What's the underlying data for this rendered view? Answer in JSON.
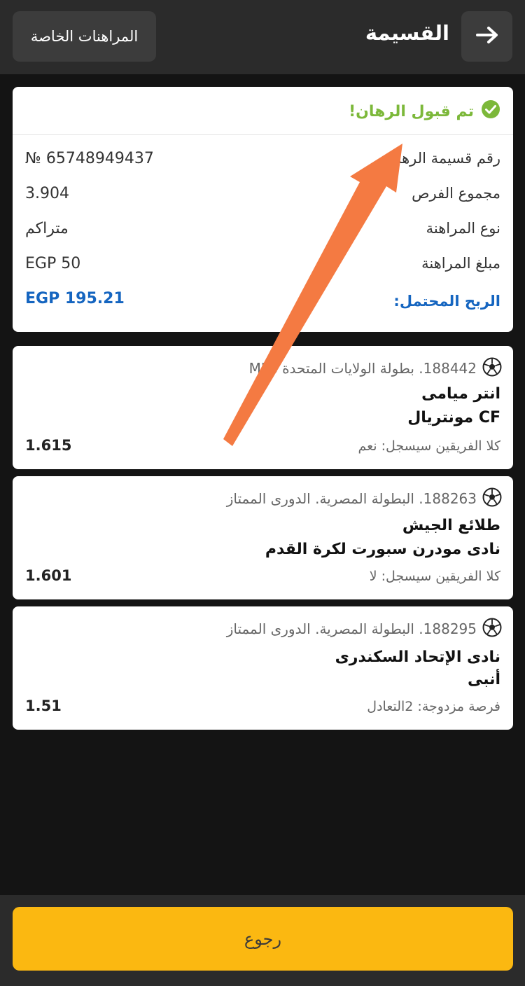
{
  "header": {
    "title": "القسيمة",
    "back_icon": "arrow-right-icon",
    "my_bets_label": "المراهنات الخاصة"
  },
  "summary": {
    "status": "تم قبول الرهان!",
    "status_color": "#7cb83a",
    "rows": [
      {
        "label": "رقم قسيمة الرهان",
        "value": "№ 65748949437"
      },
      {
        "label": "مجموع الفرص",
        "value": "3.904"
      },
      {
        "label": "نوع المراهنة",
        "value": "متراكم"
      },
      {
        "label": "مبلغ المراهنة",
        "value": "EGP 50"
      },
      {
        "label": "الربح المحتمل:",
        "value": "EGP 195.21"
      }
    ]
  },
  "events": [
    {
      "league": "188442. بطولة الولايات المتحدة MLS",
      "team1": "انتر ميامى",
      "team2": "CF مونتريال",
      "market": "كلا الفريقين سيسجل: نعم",
      "odd": "1.615"
    },
    {
      "league": "188263. البطولة المصرية. الدورى الممتاز",
      "team1": "طلائع الجيش",
      "team2": "نادى مودرن سبورت لكرة القدم",
      "market": "كلا الفريقين سيسجل: لا",
      "odd": "1.601"
    },
    {
      "league": "188295. البطولة المصرية. الدورى الممتاز",
      "team1": "نادى الإتحاد السكندرى",
      "team2": "أنبى",
      "market": "فرصة مزدوجة: 2التعادل",
      "odd": "1.51"
    }
  ],
  "footer": {
    "return_label": "رجوع",
    "button_color": "#fbb811"
  },
  "annotation": {
    "arrow_color": "#f47a42"
  }
}
